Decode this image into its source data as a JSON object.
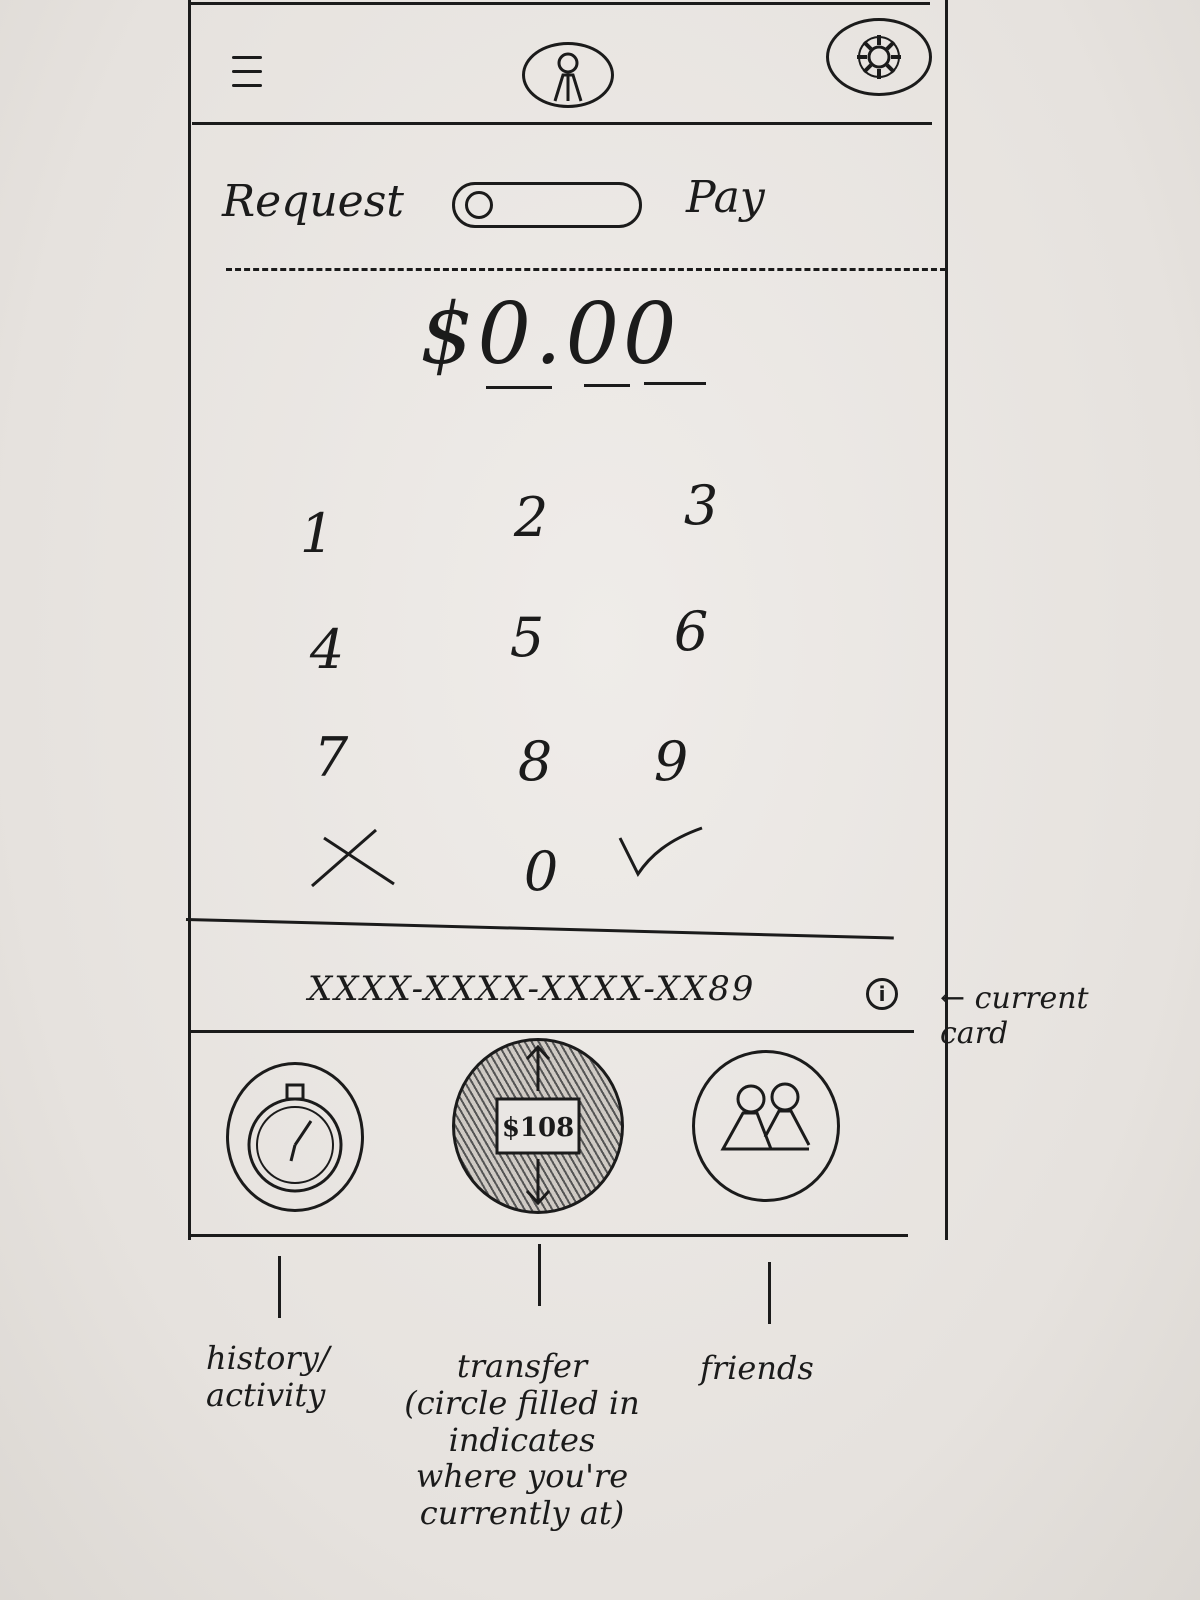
{
  "header": {
    "menu_icon": "hamburger-icon",
    "profile_icon": "user-icon",
    "settings_icon": "gear-icon"
  },
  "mode_toggle": {
    "left_label": "Request",
    "right_label": "Pay",
    "state": "Request"
  },
  "amount": {
    "value": "$0.00"
  },
  "keypad": {
    "keys": [
      "1",
      "2",
      "3",
      "4",
      "5",
      "6",
      "7",
      "8",
      "9",
      "0"
    ],
    "cancel_icon": "x-icon",
    "confirm_icon": "checkmark-icon"
  },
  "card": {
    "number": "XXXX-XXXX-XXXX-XX89",
    "info_icon": "i",
    "annotation": "← current card"
  },
  "bottom_nav": {
    "items": [
      {
        "icon": "stopwatch-icon",
        "label": "history/ activity",
        "active": false
      },
      {
        "icon": "money-transfer-icon",
        "label": "transfer (circle filled in indicates where you're currently at)",
        "active": true
      },
      {
        "icon": "friends-icon",
        "label": "friends",
        "active": false
      }
    ]
  },
  "colors": {
    "paper": "#e9e6e3",
    "ink": "#1b1b1b"
  }
}
